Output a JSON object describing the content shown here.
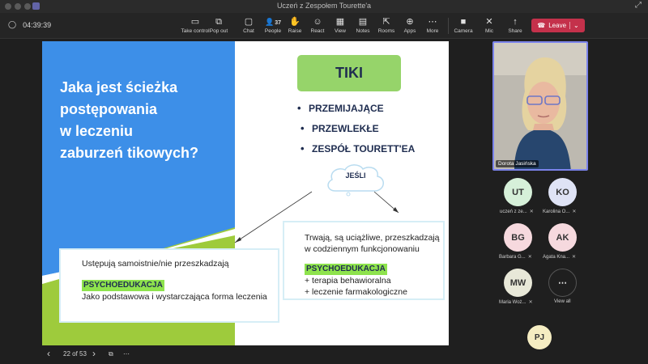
{
  "window": {
    "title": "Uczeń z Zespołem Tourette'a",
    "restore_icon": "⤢"
  },
  "toolbar": {
    "timer": "04:39:39",
    "items": [
      {
        "label": "Take control",
        "icon": "▭"
      },
      {
        "label": "Pop out",
        "icon": "⧉"
      },
      {
        "label": "Chat",
        "icon": "▢"
      },
      {
        "label": "People",
        "icon": "👤",
        "count": "37"
      },
      {
        "label": "Raise",
        "icon": "✋"
      },
      {
        "label": "React",
        "icon": "☺"
      },
      {
        "label": "View",
        "icon": "▦"
      },
      {
        "label": "Notes",
        "icon": "▤"
      },
      {
        "label": "Rooms",
        "icon": "⇱"
      },
      {
        "label": "Apps",
        "icon": "⊕"
      },
      {
        "label": "More",
        "icon": "⋯"
      },
      {
        "label": "Camera",
        "icon": "■"
      },
      {
        "label": "Mic",
        "icon": "✕"
      },
      {
        "label": "Share",
        "icon": "↑"
      }
    ],
    "leave_label": "Leave"
  },
  "slide": {
    "title_lines": [
      "Jaka jest ścieżka",
      "postępowania",
      "w leczeniu",
      "zaburzeń tikowych?"
    ],
    "tiki_label": "TIKI",
    "bullets": [
      "PRZEMIJAJĄCE",
      "PRZEWLEKŁE",
      "ZESPÓŁ TOURETT'EA"
    ],
    "cloud_label": "JEŚLI",
    "left_box": {
      "line1": "Ustępują samoistnie/nie przeszkadzają",
      "highlight": "PSYCHOEDUKACJA",
      "line2": "Jako podstawowa i wystarczająca forma leczenia"
    },
    "right_box": {
      "line1": "Trwają, są uciążliwe, przeszkadzają",
      "line2": "w codziennym funkcjonowaniu",
      "highlight": "PSYCHOEDUKACJA",
      "line3": "+ terapia behawioralna",
      "line4": "+ leczenie farmakologiczne"
    },
    "colors": {
      "blue": "#3d8fe8",
      "green": "#9ecb3c",
      "navy": "#1f2d50",
      "highlight": "#8ee34d"
    }
  },
  "slide_nav": {
    "counter": "22 of 53",
    "prev": "‹",
    "next": "›",
    "grid_icon": "⧉",
    "more": "⋯"
  },
  "video": {
    "name": "Dorota Jasińska"
  },
  "participants": [
    {
      "initials": "UT",
      "label": "uczeń z ze...",
      "color": "#d6f0d9"
    },
    {
      "initials": "KO",
      "label": "Karolina O...",
      "color": "#dfe3f5"
    },
    {
      "initials": "BG",
      "label": "Barbara G...",
      "color": "#f6d9de"
    },
    {
      "initials": "AK",
      "label": "Agata Kna...",
      "color": "#f6d9de"
    },
    {
      "initials": "MW",
      "label": "Maria Woż...",
      "color": "#e8e8d8"
    },
    {
      "initials": "⋯",
      "label": "View all",
      "color": "#2b2b2b"
    }
  ],
  "self_avatar": "PJ",
  "mic_muted_icon": "🔇"
}
